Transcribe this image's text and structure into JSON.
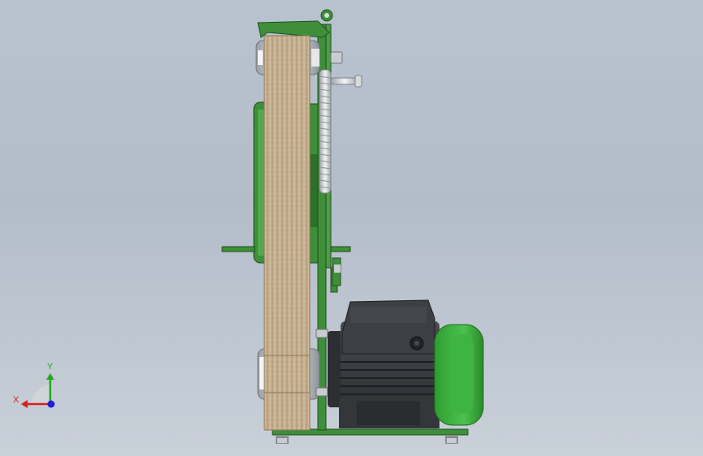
{
  "viewport": {
    "background_top": "#b9c3cf",
    "background_bottom": "#c9d0d8"
  },
  "model": {
    "frame_color": "#3f8f3a",
    "frame_dark": "#2b6a27",
    "belt_color": "#c9b496",
    "motor_body_color": "#3b3d42",
    "motor_fan_cover_color": "#38a83a",
    "metal_color": "#d8dadc"
  },
  "triad": {
    "x_label": "X",
    "y_label": "Y",
    "x_color": "#d42020",
    "y_color": "#22aa22",
    "z_color": "#2020d4"
  }
}
